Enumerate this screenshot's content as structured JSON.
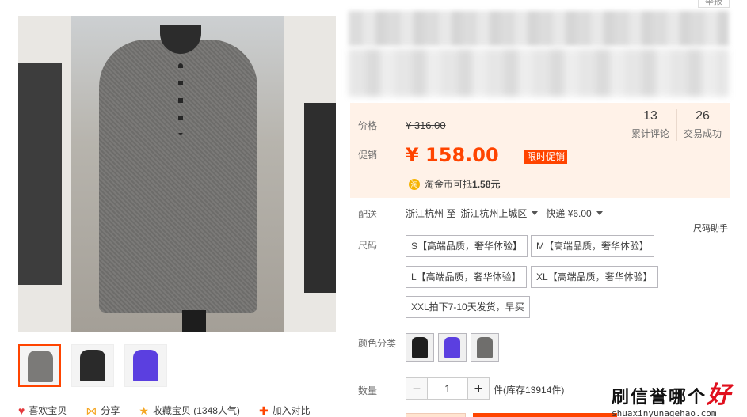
{
  "header": {
    "report_label": "举报"
  },
  "gallery": {
    "thumbnails": [
      {
        "name": "gray-dress-thumb",
        "color": "#7b7a78"
      },
      {
        "name": "black-dress-thumb",
        "color": "#2a2a2a"
      },
      {
        "name": "purple-dress-thumb",
        "color": "#5b3fe0"
      }
    ],
    "actions": [
      {
        "icon": "heart-icon",
        "glyph": "♥",
        "label": "喜欢宝贝"
      },
      {
        "icon": "share-icon",
        "glyph": "⋈",
        "label": "分享"
      },
      {
        "icon": "star-icon",
        "glyph": "★",
        "label": "收藏宝贝 (1348人气)"
      },
      {
        "icon": "plus-icon",
        "glyph": "✚",
        "label": "加入对比"
      }
    ]
  },
  "price": {
    "price_label": "价格",
    "original_price": "¥ 316.00",
    "promo_label": "促销",
    "promo_price": "¥ 158.00",
    "promo_tag": "限时促销",
    "coin_icon": "淘",
    "coin_text_prefix": "淘金币可抵",
    "coin_amount": "1.58元",
    "reviews_count": "13",
    "reviews_label": "累计评论",
    "sales_count": "26",
    "sales_label": "交易成功"
  },
  "shipping": {
    "label": "配送",
    "origin": "浙江杭州 至",
    "destination": "浙江杭州上城区",
    "express": "快递 ¥6.00"
  },
  "size": {
    "label": "尺码",
    "helper": "尺码助手",
    "options": [
      "S【高端品质，奢华体验】",
      "M【高端品质，奢华体验】",
      "L【高端品质，奢华体验】",
      "XL【高端品质，奢华体验】",
      "XXL拍下7-10天发货，早买"
    ]
  },
  "color": {
    "label": "颜色分类",
    "options": [
      {
        "name": "black",
        "color": "#1e1e1e"
      },
      {
        "name": "purple",
        "color": "#5b3fe0"
      },
      {
        "name": "gray",
        "color": "#6f6e6c"
      }
    ]
  },
  "quantity": {
    "label": "数量",
    "minus": "−",
    "value": "1",
    "plus": "+",
    "unit_stock": "件(库存13914件)"
  },
  "watermark": {
    "text": "刷信誉哪个",
    "big": "好",
    "url": "shuaxinyunagehao.com"
  }
}
